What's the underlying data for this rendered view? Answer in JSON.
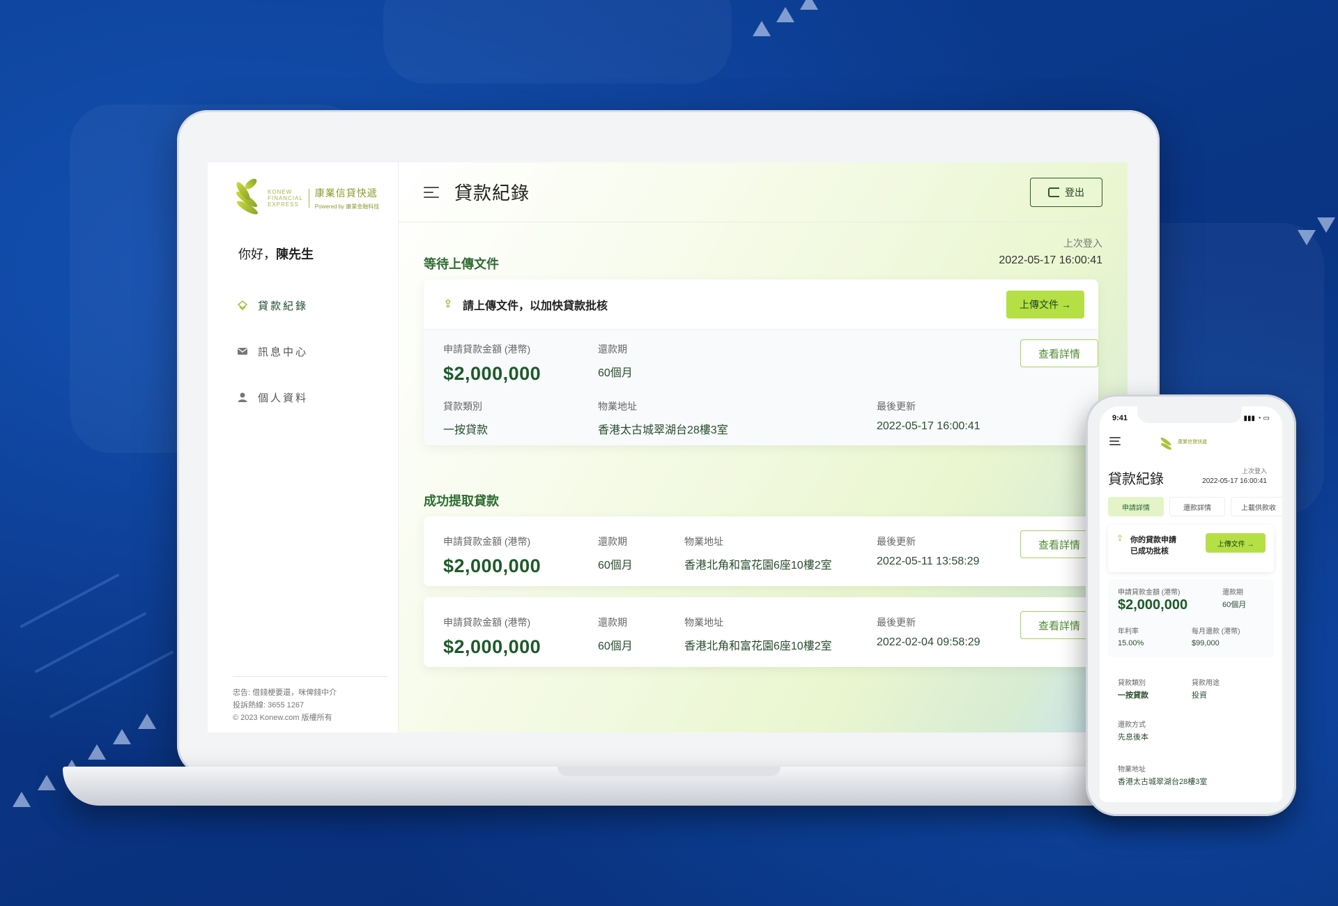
{
  "colors": {
    "accent_green": "#b4e045",
    "dark_green": "#1d5a2a",
    "background_blue": "#0a3a8a"
  },
  "desktop": {
    "logo": {
      "en": [
        "KONEW",
        "FINANCIAL",
        "EXPRESS"
      ],
      "zh": "康業信貸快遞",
      "sub": "Powered by 康業金融科技"
    },
    "greeting_prefix": "你好，",
    "greeting_name": "陳先生",
    "nav": [
      {
        "label": "貸款紀錄",
        "icon": "loan-icon"
      },
      {
        "label": "訊息中心",
        "icon": "mail-icon"
      },
      {
        "label": "個人資料",
        "icon": "user-icon"
      }
    ],
    "footer": [
      "忠告: 借錢梗要還，咪俾錢中介",
      "投訴熱線: 3655 1267",
      "© 2023 Konew.com 版權所有"
    ],
    "page_title": "貸款紀錄",
    "logout_label": "登出",
    "last_login_label": "上次登入",
    "last_login_value": "2022-05-17   16:00:41",
    "pending": {
      "title": "等待上傳文件",
      "notice": "請上傳文件，以加快貸款批核",
      "upload_label": "上傳文件 →",
      "amount_label": "申請貸款金額 (港幣)",
      "amount": "$2,000,000",
      "term_label": "還款期",
      "term": "60個月",
      "type_label": "貸款類別",
      "type": "一按貸款",
      "address_label": "物業地址",
      "address": "香港太古城翠湖台28樓3室",
      "updated_label": "最後更新",
      "updated": "2022-05-17   16:00:41",
      "detail_label": "查看詳情"
    },
    "success": {
      "title": "成功提取貸款",
      "items": [
        {
          "amount_label": "申請貸款金額 (港幣)",
          "amount": "$2,000,000",
          "term_label": "還款期",
          "term": "60個月",
          "address_label": "物業地址",
          "address": "香港北角和富花園6座10樓2室",
          "updated_label": "最後更新",
          "updated": "2022-05-11  13:58:29",
          "detail_label": "查看詳情"
        },
        {
          "amount_label": "申請貸款金額 (港幣)",
          "amount": "$2,000,000",
          "term_label": "還款期",
          "term": "60個月",
          "address_label": "物業地址",
          "address": "香港北角和富花園6座10樓2室",
          "updated_label": "最後更新",
          "updated": "2022-02-04  09:58:29",
          "detail_label": "查看詳情"
        }
      ]
    }
  },
  "mobile": {
    "time": "9:41",
    "title": "貸款紀錄",
    "last_login_label": "上次登入",
    "last_login_value": "2022-05-17   16:00:41",
    "tabs": [
      "申請詳情",
      "還款詳情",
      "上載供款收"
    ],
    "notice": [
      "你的貸款申請",
      "已成功批核"
    ],
    "upload_label": "上傳文件 →",
    "amount_label": "申請貸款金額 (港幣)",
    "amount": "$2,000,000",
    "term_label": "還款期",
    "term": "60個月",
    "rate_label": "年利率",
    "rate": "15.00%",
    "monthly_label": "每月還款 (港幣)",
    "monthly": "$99,000",
    "type_label": "貸款類別",
    "type": "一按貸款",
    "purpose_label": "貸款用途",
    "purpose": "投資",
    "method_label": "還款方式",
    "method": "先息後本",
    "address_label": "物業地址",
    "address": "香港太古城翠湖台28樓3室"
  }
}
